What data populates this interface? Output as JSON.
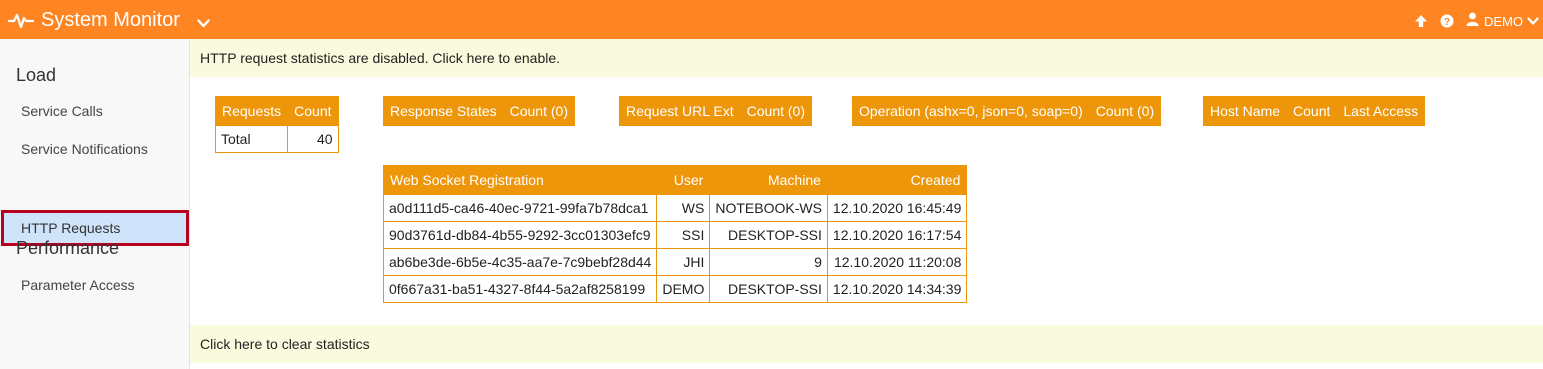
{
  "app": {
    "title": "System Monitor",
    "user": "DEMO"
  },
  "colors": {
    "topbar": "#ff8522",
    "table_header": "#ee960a",
    "banner": "#fafade",
    "active_item": "#cfe3fb",
    "active_border": "#b8001f"
  },
  "icons": [
    "heartbeat-icon",
    "chevron-down-icon",
    "arrow-up-icon",
    "help-icon",
    "user-icon"
  ],
  "sidebar": {
    "sections": [
      {
        "title": "Load",
        "items": [
          "Service Calls",
          "Service Notifications",
          "HTTP Requests"
        ]
      },
      {
        "title": "Performance",
        "items": [
          "Parameter Access"
        ]
      }
    ],
    "active": "HTTP Requests"
  },
  "main": {
    "banner_enable": "HTTP request statistics are disabled. Click here to enable.",
    "banner_clear": "Click here to clear statistics",
    "requests_table": {
      "headers": [
        "Requests",
        "Count"
      ],
      "rows": [
        [
          "Total",
          "40"
        ]
      ]
    },
    "response_states": {
      "headers": [
        "Response States",
        "Count (0)"
      ]
    },
    "request_url_ext": {
      "headers": [
        "Request URL Ext",
        "Count (0)"
      ]
    },
    "operation": {
      "headers": [
        "Operation (ashx=0, json=0, soap=0)",
        "Count (0)"
      ]
    },
    "host_name": {
      "headers": [
        "Host Name",
        "Count",
        "Last Access"
      ]
    },
    "websocket_table": {
      "headers": [
        "Web Socket Registration",
        "User",
        "Machine",
        "Created"
      ],
      "rows": [
        [
          "a0d111d5-ca46-40ec-9721-99fa7b78dca1",
          "WS",
          "NOTEBOOK-WS",
          "12.10.2020 16:45:49"
        ],
        [
          "90d3761d-db84-4b55-9292-3cc01303efc9",
          "SSI",
          "DESKTOP-SSI",
          "12.10.2020 16:17:54"
        ],
        [
          "ab6be3de-6b5e-4c35-aa7e-7c9bebf28d44",
          "JHI",
          "9",
          "12.10.2020 11:20:08"
        ],
        [
          "0f667a31-ba51-4327-8f44-5a2af8258199",
          "DEMO",
          "DESKTOP-SSI",
          "12.10.2020 14:34:39"
        ]
      ]
    }
  }
}
